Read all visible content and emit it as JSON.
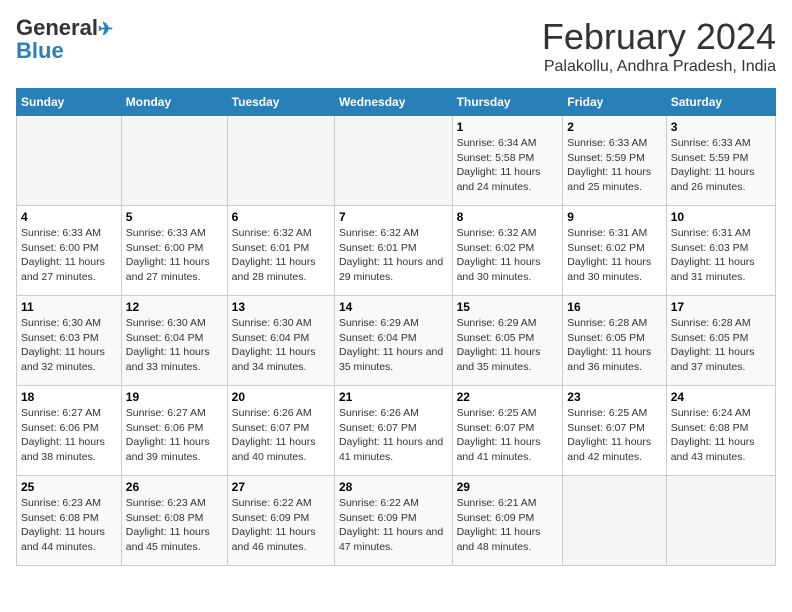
{
  "header": {
    "logo_line1": "General",
    "logo_line2": "Blue",
    "month_title": "February 2024",
    "location": "Palakollu, Andhra Pradesh, India"
  },
  "days_of_week": [
    "Sunday",
    "Monday",
    "Tuesday",
    "Wednesday",
    "Thursday",
    "Friday",
    "Saturday"
  ],
  "weeks": [
    [
      {
        "day": "",
        "content": ""
      },
      {
        "day": "",
        "content": ""
      },
      {
        "day": "",
        "content": ""
      },
      {
        "day": "",
        "content": ""
      },
      {
        "day": "1",
        "content": "Sunrise: 6:34 AM\nSunset: 5:58 PM\nDaylight: 11 hours and 24 minutes."
      },
      {
        "day": "2",
        "content": "Sunrise: 6:33 AM\nSunset: 5:59 PM\nDaylight: 11 hours and 25 minutes."
      },
      {
        "day": "3",
        "content": "Sunrise: 6:33 AM\nSunset: 5:59 PM\nDaylight: 11 hours and 26 minutes."
      }
    ],
    [
      {
        "day": "4",
        "content": "Sunrise: 6:33 AM\nSunset: 6:00 PM\nDaylight: 11 hours and 27 minutes."
      },
      {
        "day": "5",
        "content": "Sunrise: 6:33 AM\nSunset: 6:00 PM\nDaylight: 11 hours and 27 minutes."
      },
      {
        "day": "6",
        "content": "Sunrise: 6:32 AM\nSunset: 6:01 PM\nDaylight: 11 hours and 28 minutes."
      },
      {
        "day": "7",
        "content": "Sunrise: 6:32 AM\nSunset: 6:01 PM\nDaylight: 11 hours and 29 minutes."
      },
      {
        "day": "8",
        "content": "Sunrise: 6:32 AM\nSunset: 6:02 PM\nDaylight: 11 hours and 30 minutes."
      },
      {
        "day": "9",
        "content": "Sunrise: 6:31 AM\nSunset: 6:02 PM\nDaylight: 11 hours and 30 minutes."
      },
      {
        "day": "10",
        "content": "Sunrise: 6:31 AM\nSunset: 6:03 PM\nDaylight: 11 hours and 31 minutes."
      }
    ],
    [
      {
        "day": "11",
        "content": "Sunrise: 6:30 AM\nSunset: 6:03 PM\nDaylight: 11 hours and 32 minutes."
      },
      {
        "day": "12",
        "content": "Sunrise: 6:30 AM\nSunset: 6:04 PM\nDaylight: 11 hours and 33 minutes."
      },
      {
        "day": "13",
        "content": "Sunrise: 6:30 AM\nSunset: 6:04 PM\nDaylight: 11 hours and 34 minutes."
      },
      {
        "day": "14",
        "content": "Sunrise: 6:29 AM\nSunset: 6:04 PM\nDaylight: 11 hours and 35 minutes."
      },
      {
        "day": "15",
        "content": "Sunrise: 6:29 AM\nSunset: 6:05 PM\nDaylight: 11 hours and 35 minutes."
      },
      {
        "day": "16",
        "content": "Sunrise: 6:28 AM\nSunset: 6:05 PM\nDaylight: 11 hours and 36 minutes."
      },
      {
        "day": "17",
        "content": "Sunrise: 6:28 AM\nSunset: 6:05 PM\nDaylight: 11 hours and 37 minutes."
      }
    ],
    [
      {
        "day": "18",
        "content": "Sunrise: 6:27 AM\nSunset: 6:06 PM\nDaylight: 11 hours and 38 minutes."
      },
      {
        "day": "19",
        "content": "Sunrise: 6:27 AM\nSunset: 6:06 PM\nDaylight: 11 hours and 39 minutes."
      },
      {
        "day": "20",
        "content": "Sunrise: 6:26 AM\nSunset: 6:07 PM\nDaylight: 11 hours and 40 minutes."
      },
      {
        "day": "21",
        "content": "Sunrise: 6:26 AM\nSunset: 6:07 PM\nDaylight: 11 hours and 41 minutes."
      },
      {
        "day": "22",
        "content": "Sunrise: 6:25 AM\nSunset: 6:07 PM\nDaylight: 11 hours and 41 minutes."
      },
      {
        "day": "23",
        "content": "Sunrise: 6:25 AM\nSunset: 6:07 PM\nDaylight: 11 hours and 42 minutes."
      },
      {
        "day": "24",
        "content": "Sunrise: 6:24 AM\nSunset: 6:08 PM\nDaylight: 11 hours and 43 minutes."
      }
    ],
    [
      {
        "day": "25",
        "content": "Sunrise: 6:23 AM\nSunset: 6:08 PM\nDaylight: 11 hours and 44 minutes."
      },
      {
        "day": "26",
        "content": "Sunrise: 6:23 AM\nSunset: 6:08 PM\nDaylight: 11 hours and 45 minutes."
      },
      {
        "day": "27",
        "content": "Sunrise: 6:22 AM\nSunset: 6:09 PM\nDaylight: 11 hours and 46 minutes."
      },
      {
        "day": "28",
        "content": "Sunrise: 6:22 AM\nSunset: 6:09 PM\nDaylight: 11 hours and 47 minutes."
      },
      {
        "day": "29",
        "content": "Sunrise: 6:21 AM\nSunset: 6:09 PM\nDaylight: 11 hours and 48 minutes."
      },
      {
        "day": "",
        "content": ""
      },
      {
        "day": "",
        "content": ""
      }
    ]
  ]
}
